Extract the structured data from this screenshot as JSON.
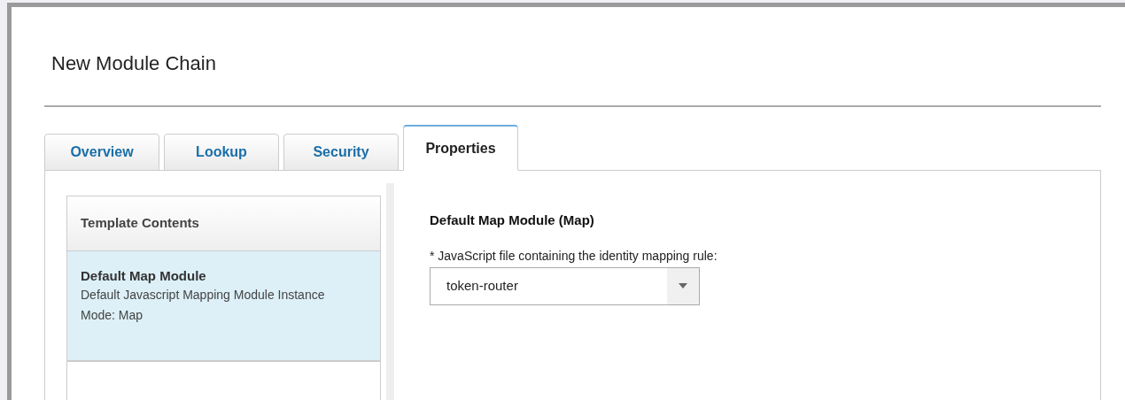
{
  "dialog": {
    "title": "New Module Chain"
  },
  "tabs": [
    {
      "label": "Overview",
      "selected": false
    },
    {
      "label": "Lookup",
      "selected": false
    },
    {
      "label": "Security",
      "selected": false
    },
    {
      "label": "Properties",
      "selected": true
    }
  ],
  "template_contents": {
    "heading": "Template Contents",
    "items": [
      {
        "name": "Default Map Module",
        "lines": [
          "Default Javascript Mapping Module Instance",
          "Mode: Map"
        ],
        "selected": true
      }
    ]
  },
  "properties": {
    "heading": "Default Map Module (Map)",
    "field_label": "* JavaScript file containing the identity mapping rule:",
    "value": "token-router"
  }
}
